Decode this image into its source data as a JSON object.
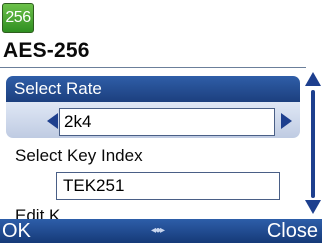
{
  "status": {
    "badge": "256"
  },
  "header": {
    "title": "AES-256"
  },
  "list": {
    "items": [
      {
        "label": "Select Rate",
        "value": "2k4"
      },
      {
        "label": "Select Key Index",
        "value": "TEK251"
      },
      {
        "label": "Edit K"
      }
    ]
  },
  "softkeys": {
    "left": "OK",
    "center": "◂●▸",
    "right": "Close"
  },
  "colors": {
    "highlight": "#244a91",
    "accent_green": "#3f9f2c",
    "softkey_bar": "#1f4788"
  },
  "icons": [
    "left-arrow-icon",
    "right-arrow-icon",
    "scroll-up-icon",
    "scroll-down-icon",
    "nav-icon"
  ]
}
